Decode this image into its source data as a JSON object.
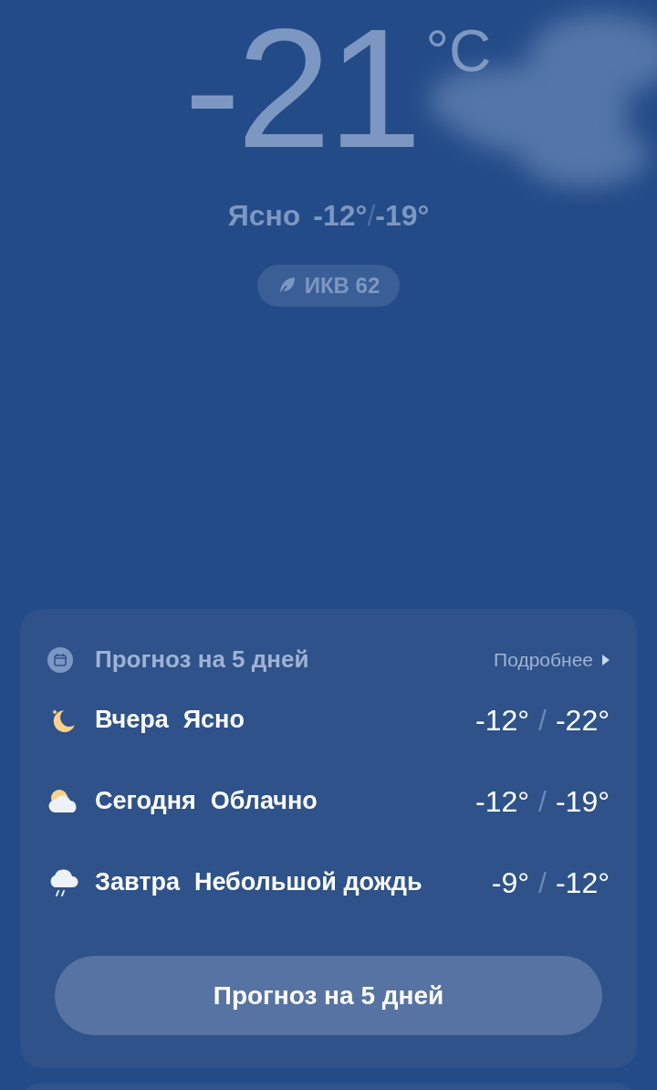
{
  "current": {
    "temperature": "-21",
    "unit": "°C",
    "condition": "Ясно",
    "high": "-12°",
    "separator": "/",
    "low": "-19°"
  },
  "aqi": {
    "label": "ИКВ 62"
  },
  "forecast": {
    "title": "Прогноз на 5 дней",
    "more": "Подробнее",
    "days": [
      {
        "kind": "moon",
        "day": "Вчера",
        "condition": "Ясно",
        "high": "-12°",
        "separator": "/",
        "low": "-22°"
      },
      {
        "kind": "partly-cloudy",
        "day": "Сегодня",
        "condition": "Облачно",
        "high": "-12°",
        "separator": "/",
        "low": "-19°"
      },
      {
        "kind": "rain",
        "day": "Завтра",
        "condition": "Небольшой дождь",
        "high": "-9°",
        "separator": "/",
        "low": "-12°"
      }
    ],
    "button": "Прогноз на 5 дней"
  }
}
